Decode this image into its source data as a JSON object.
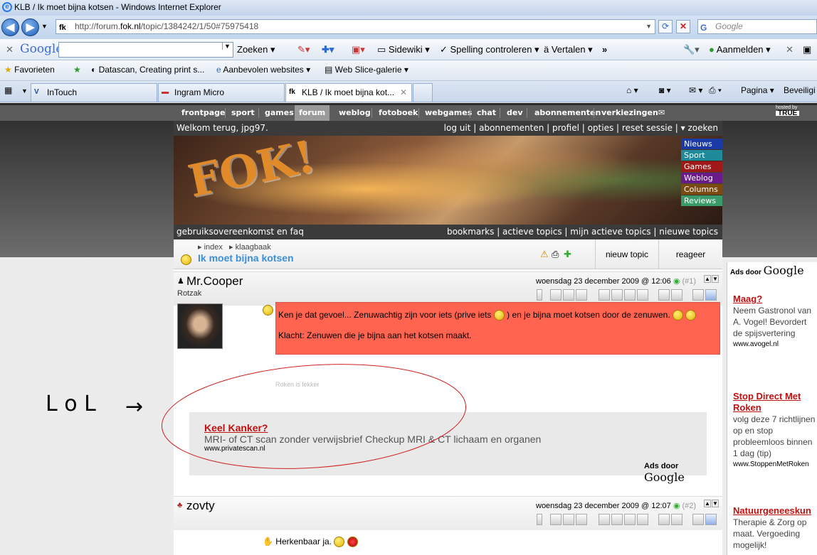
{
  "window": {
    "title": "KLB / Ik moet bijna kotsen - Windows Internet Explorer"
  },
  "address": {
    "url_prefix": "http://forum.",
    "url_domain": "fok.nl",
    "url_path": "/topic/1384242/1/50#75975418",
    "search_placeholder": "Google"
  },
  "google_toolbar": {
    "brand": "Google",
    "search": "Zoeken",
    "sidewiki": "Sidewiki",
    "spelling": "Spelling controleren",
    "translate": "Vertalen",
    "more": "»",
    "signin": "Aanmelden"
  },
  "favorites_bar": {
    "favorites": "Favorieten",
    "item1": "Datascan, Creating print s...",
    "item2": "Aanbevolen websites",
    "item3": "Web Slice-galerie"
  },
  "tabs": [
    {
      "label": "InTouch"
    },
    {
      "label": "Ingram Micro"
    },
    {
      "label": "KLB / Ik moet bijna kot..."
    }
  ],
  "tab_tools": {
    "page": "Pagina",
    "security": "Beveiligi"
  },
  "site_nav": [
    "frontpage",
    "sport",
    "games",
    "forum",
    "weblog",
    "fotoboek",
    "webgames",
    "chat",
    "dev",
    "abonnementen",
    "verkiezingen"
  ],
  "hosted": {
    "label": "hosted by",
    "brand": "TRUE"
  },
  "welcome": {
    "text": "Welkom terug, jpg97.",
    "links": "log uit | abonnementen | profiel | opties | reset sessie | ▾ zoeken"
  },
  "banner": {
    "logo": "FOK!",
    "side_tabs": [
      "Nieuws",
      "Sport",
      "Games",
      "Weblog",
      "Columns",
      "Reviews"
    ]
  },
  "subbar": {
    "left": "gebruiksovereenkomst en faq",
    "right": "bookmarks | actieve topics | mijn actieve topics | nieuwe topics"
  },
  "topic": {
    "crumb1": "index",
    "crumb2": "klaagbaak",
    "title": "Ik moet bijna kotsen",
    "new_topic": "nieuw topic",
    "reply": "reageer"
  },
  "post1": {
    "author": "Mr.Cooper",
    "user_title": "Rotzak",
    "date": "woensdag 23 december 2009 @ 12:06",
    "num": "(#1)",
    "line1": "Ken je dat gevoel... Zenuwachtig zijn voor iets (prive iets",
    "line1b": ") en je bijna moet kotsen door de zenuwen.",
    "line2": "Klacht: Zenuwen die je bijna aan het kotsen maakt.",
    "signature": "Roken is lekker"
  },
  "inline_ad": {
    "title": "Keel Kanker?",
    "desc": "MRI- of CT scan zonder verwijsbrief Checkup MRI & CT lichaam en organen",
    "url": "www.privatescan.nl",
    "adsby": "Ads door",
    "adsby_brand": "Google"
  },
  "annotation": {
    "text": "L o L",
    "arrow": "→"
  },
  "post2": {
    "author": "zovty",
    "date": "woensdag 23 december 2009 @ 12:07",
    "num": "(#2)",
    "line1": "Herkenbaar ja."
  },
  "right_ads": {
    "adsby": "Ads door",
    "adsby_brand": "Google",
    "ads": [
      {
        "title": "Maag?",
        "desc": "Neem Gastronol van A. Vogel! Bevordert de spijsvertering",
        "url": "www.avogel.nl"
      },
      {
        "title": "Stop Direct Met Roken",
        "desc": "volg deze 7 richtlijnen op en stop probleemloos binnen 1 dag (tip)",
        "url": "www.StoppenMetRoken"
      },
      {
        "title": "Natuurgeneeskun",
        "desc": "Therapie & Zorg op maat. Vergoeding mogelijk!",
        "url": ""
      }
    ]
  },
  "colors": {
    "post_bg": "#ff6450",
    "link_red": "#c01010",
    "title_blue": "#3a8fd9"
  }
}
